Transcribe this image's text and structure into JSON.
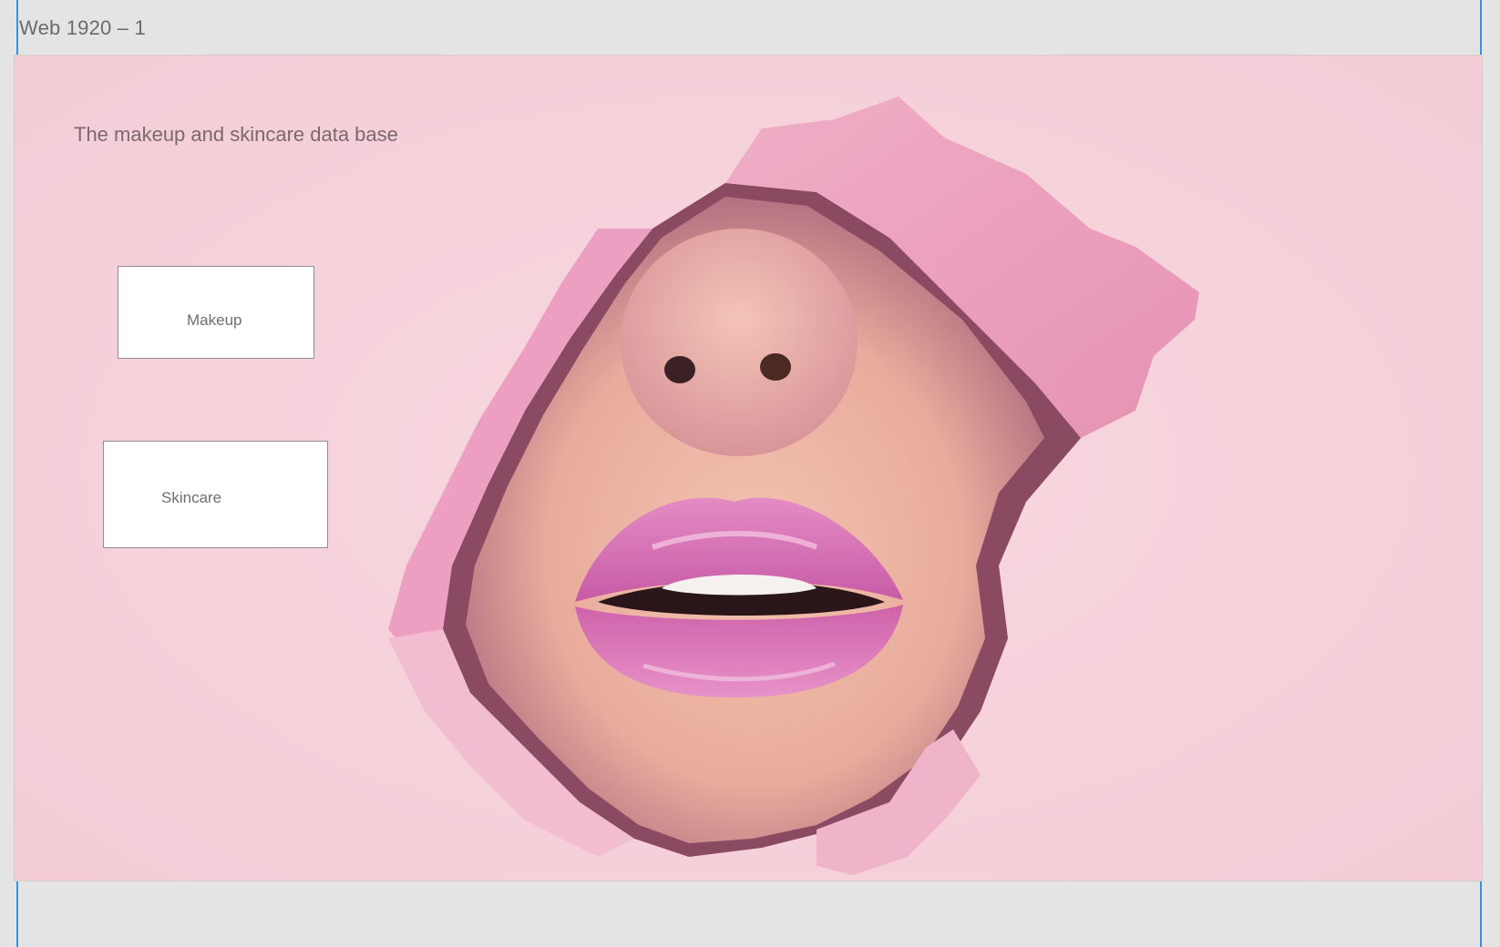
{
  "artboard": {
    "label": "Web 1920 – 1"
  },
  "page": {
    "title": "The makeup and skincare data base"
  },
  "nav": {
    "makeup_label": "Makeup",
    "skincare_label": "Skincare"
  },
  "colors": {
    "background": "#f6d3dc",
    "lip": "#d46fb3",
    "guide": "#3b8fe0"
  }
}
